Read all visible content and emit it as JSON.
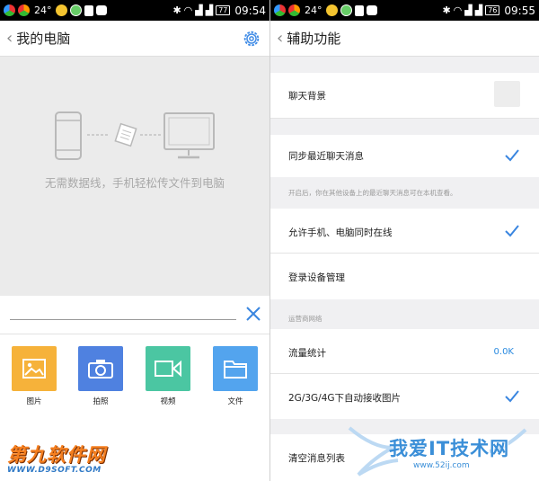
{
  "status_left": {
    "temp": "24°",
    "battery": "77",
    "time": "09:54"
  },
  "status_right": {
    "temp": "24°",
    "battery": "76",
    "time": "09:55"
  },
  "left": {
    "title": "我的电脑",
    "empty_text": "无需数据线，手机轻松传文件到电脑",
    "input_value": "",
    "tools": [
      {
        "label": "图片",
        "icon": "image-icon",
        "color": "#f6b23a"
      },
      {
        "label": "拍照",
        "icon": "camera-icon",
        "color": "#4f81e0"
      },
      {
        "label": "视频",
        "icon": "video-icon",
        "color": "#4bc6a2"
      },
      {
        "label": "文件",
        "icon": "folder-icon",
        "color": "#53a4ee"
      }
    ],
    "watermark_top": "第九软件网",
    "watermark_bottom": "WWW.D9SOFT.COM"
  },
  "right": {
    "title": "辅助功能",
    "chat_bg_label": "聊天背景",
    "sync_label": "同步最近聊天消息",
    "sync_checked": true,
    "sync_note": "开启后，你在其他设备上的最近聊天消息可在本机查看。",
    "online_label": "允许手机、电脑同时在线",
    "online_checked": true,
    "devices_label": "登录设备管理",
    "carrier_section": "运营商网络",
    "traffic_label": "流量统计",
    "traffic_value": "0.0K",
    "auto_img_label": "2G/3G/4G下自动接收图片",
    "auto_img_checked": true,
    "clear_label": "清空消息列表",
    "watermark_top": "我爱IT技术网",
    "watermark_bottom": "www.52ij.com"
  }
}
